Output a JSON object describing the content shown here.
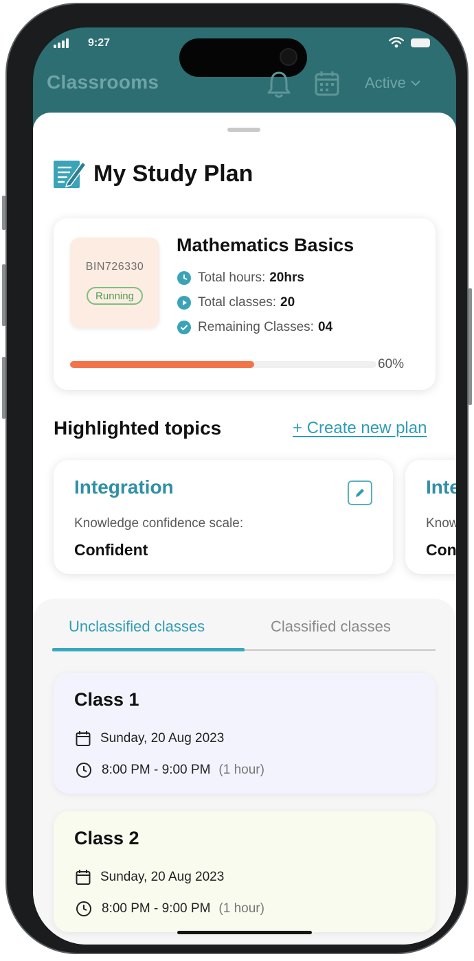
{
  "status_bar": {
    "time": "9:27"
  },
  "header": {
    "title": "Classrooms",
    "filter_label": "Active"
  },
  "study_plan": {
    "title": "My Study Plan",
    "course": {
      "code": "BIN726330",
      "status": "Running",
      "name": "Mathematics Basics",
      "stats": [
        {
          "label": "Total hours:",
          "value": "20hrs"
        },
        {
          "label": "Total classes:",
          "value": "20"
        },
        {
          "label": "Remaining Classes:",
          "value": "04"
        }
      ],
      "progress_percent": 60,
      "progress_label": "60%"
    }
  },
  "topics": {
    "title": "Highlighted topics",
    "create_label": "+ Create new plan",
    "items": [
      {
        "name": "Integration",
        "scale_label": "Knowledge confidence scale:",
        "value": "Confident"
      },
      {
        "name": "Integration",
        "scale_label": "Knowledge confidence scale:",
        "value": "Confident"
      }
    ]
  },
  "classes": {
    "tabs": [
      {
        "label": "Unclassified classes",
        "active": true
      },
      {
        "label": "Classified classes",
        "active": false
      }
    ],
    "items": [
      {
        "title": "Class 1",
        "date": "Sunday, 20 Aug 2023",
        "time": "8:00 PM - 9:00 PM",
        "duration": "(1 hour)",
        "color": "#f3f3fd"
      },
      {
        "title": "Class 2",
        "date": "Sunday, 20 Aug 2023",
        "time": "8:00 PM - 9:00 PM",
        "duration": "(1 hour)",
        "color": "#f9fbef"
      }
    ]
  },
  "colors": {
    "accent": "#2f9db5",
    "header_bg": "#2c6e72",
    "progress": "#f2754a",
    "running": "#4f9f4f"
  }
}
